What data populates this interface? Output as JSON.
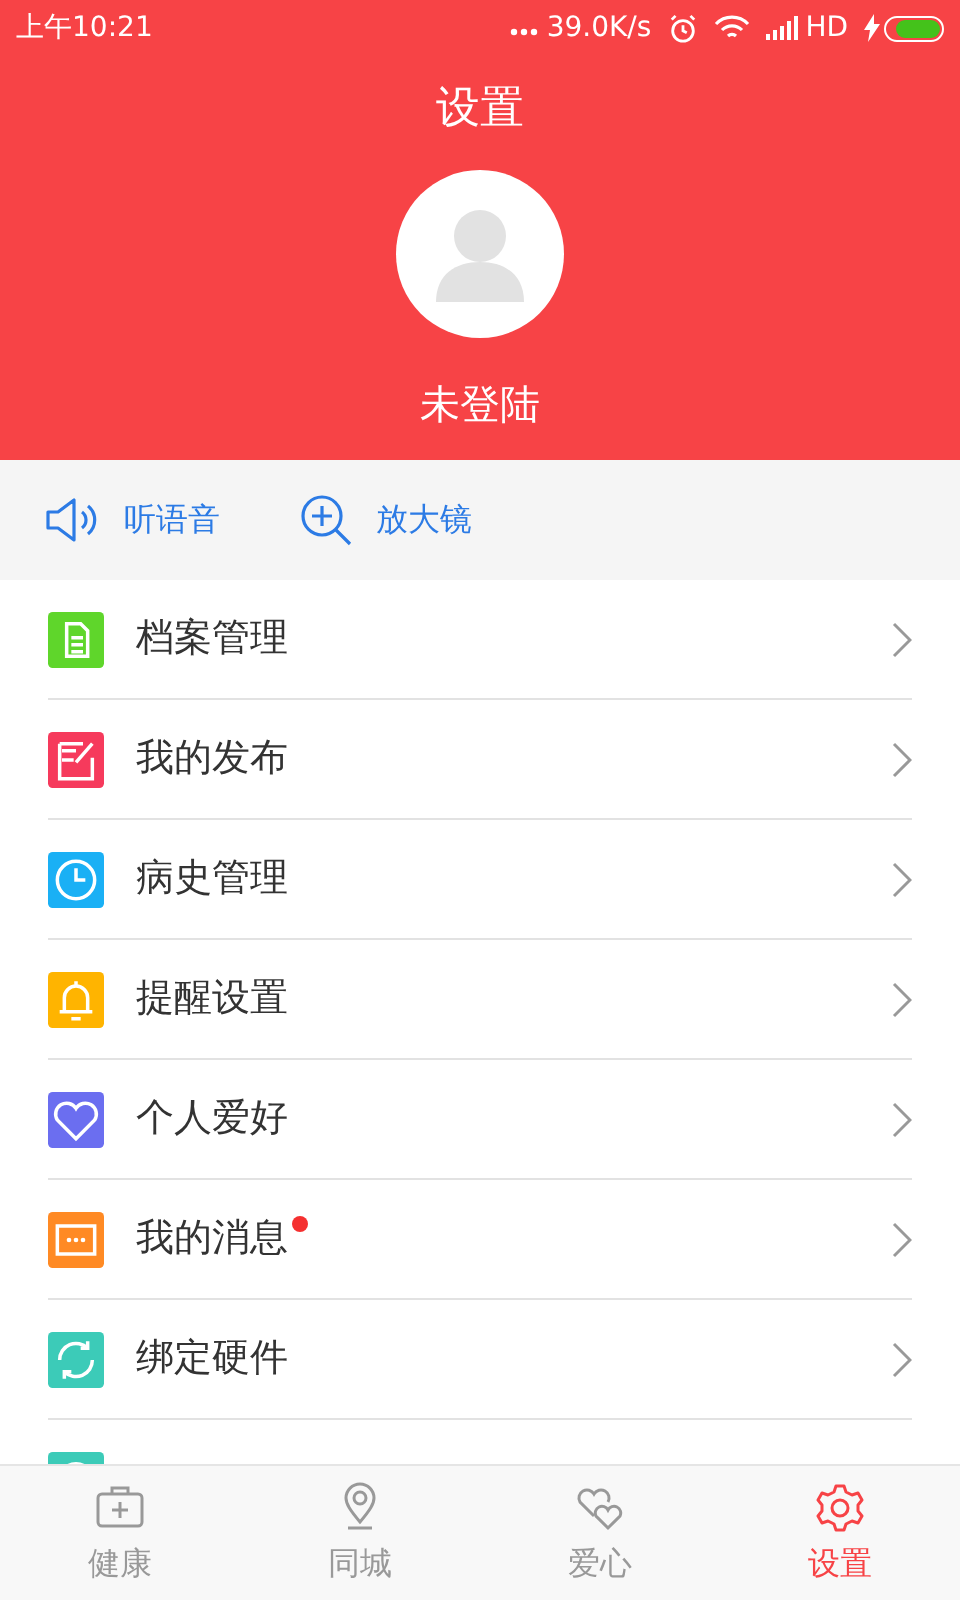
{
  "status_bar": {
    "time": "上午10:21",
    "speed": "39.0K/s",
    "network": "HD"
  },
  "header": {
    "title": "设置",
    "user": "未登陆"
  },
  "tools": [
    {
      "kind": "speaker",
      "label": "听语音"
    },
    {
      "kind": "zoom",
      "label": "放大镜"
    }
  ],
  "menu": [
    {
      "kind": "document",
      "label": "档案管理",
      "color": "#5fd62b",
      "unread": false
    },
    {
      "kind": "edit",
      "label": "我的发布",
      "color": "#f63a5c",
      "unread": false
    },
    {
      "kind": "clock",
      "label": "病史管理",
      "color": "#1ab0f5",
      "unread": false
    },
    {
      "kind": "bell",
      "label": "提醒设置",
      "color": "#ffb400",
      "unread": false
    },
    {
      "kind": "heart",
      "label": "个人爱好",
      "color": "#6b6ef0",
      "unread": false
    },
    {
      "kind": "message",
      "label": "我的消息",
      "color": "#ff8a24",
      "unread": true
    },
    {
      "kind": "sync",
      "label": "绑定硬件",
      "color": "#3ccbb8",
      "unread": false
    },
    {
      "kind": "circle",
      "color": "#3ccbb8"
    }
  ],
  "tabs": [
    {
      "kind": "health",
      "label": "健康",
      "selected": false
    },
    {
      "kind": "pin",
      "label": "同城",
      "selected": false
    },
    {
      "kind": "hearts",
      "label": "爱心",
      "selected": false
    },
    {
      "kind": "gear",
      "label": "设置",
      "selected": true
    }
  ]
}
